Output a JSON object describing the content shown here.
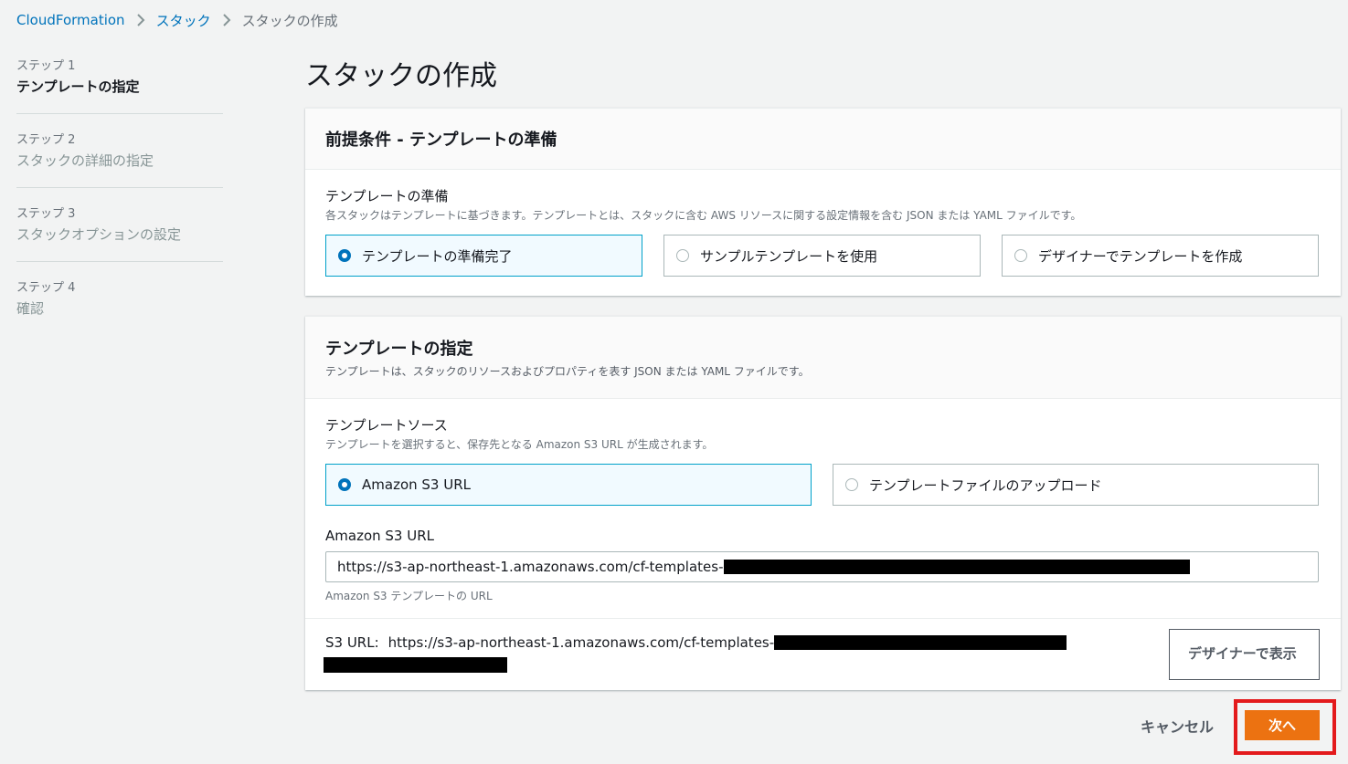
{
  "breadcrumb": {
    "items": [
      "CloudFormation",
      "スタック",
      "スタックの作成"
    ]
  },
  "steps": [
    {
      "num": "ステップ 1",
      "title": "テンプレートの指定"
    },
    {
      "num": "ステップ 2",
      "title": "スタックの詳細の指定"
    },
    {
      "num": "ステップ 3",
      "title": "スタックオプションの設定"
    },
    {
      "num": "ステップ 4",
      "title": "確認"
    }
  ],
  "page_title": "スタックの作成",
  "prereq": {
    "title": "前提条件 - テンプレートの準備",
    "field_label": "テンプレートの準備",
    "field_desc": "各スタックはテンプレートに基づきます。テンプレートとは、スタックに含む AWS リソースに関する設定情報を含む JSON または YAML ファイルです。",
    "options": [
      "テンプレートの準備完了",
      "サンプルテンプレートを使用",
      "デザイナーでテンプレートを作成"
    ],
    "selected": 0
  },
  "spec": {
    "title": "テンプレートの指定",
    "desc": "テンプレートは、スタックのリソースおよびプロパティを表す JSON または YAML ファイルです。",
    "source_label": "テンプレートソース",
    "source_desc": "テンプレートを選択すると、保存先となる Amazon S3 URL が生成されます。",
    "source_options": [
      "Amazon S3 URL",
      "テンプレートファイルのアップロード"
    ],
    "url_label": "Amazon S3 URL",
    "url_value": "https://s3-ap-northeast-1.amazonaws.com/cf-templates-",
    "url_hint": "Amazon S3 テンプレートの URL",
    "s3_url_label": "S3 URL:",
    "s3_url_value": "https://s3-ap-northeast-1.amazonaws.com/cf-templates-",
    "designer_button": "デザイナーで表示"
  },
  "footer": {
    "cancel": "キャンセル",
    "next": "次へ"
  },
  "colors": {
    "link": "#0073bb",
    "primary": "#ec7211",
    "selected_border": "#00a1c9",
    "highlight": "#e31a1c"
  }
}
